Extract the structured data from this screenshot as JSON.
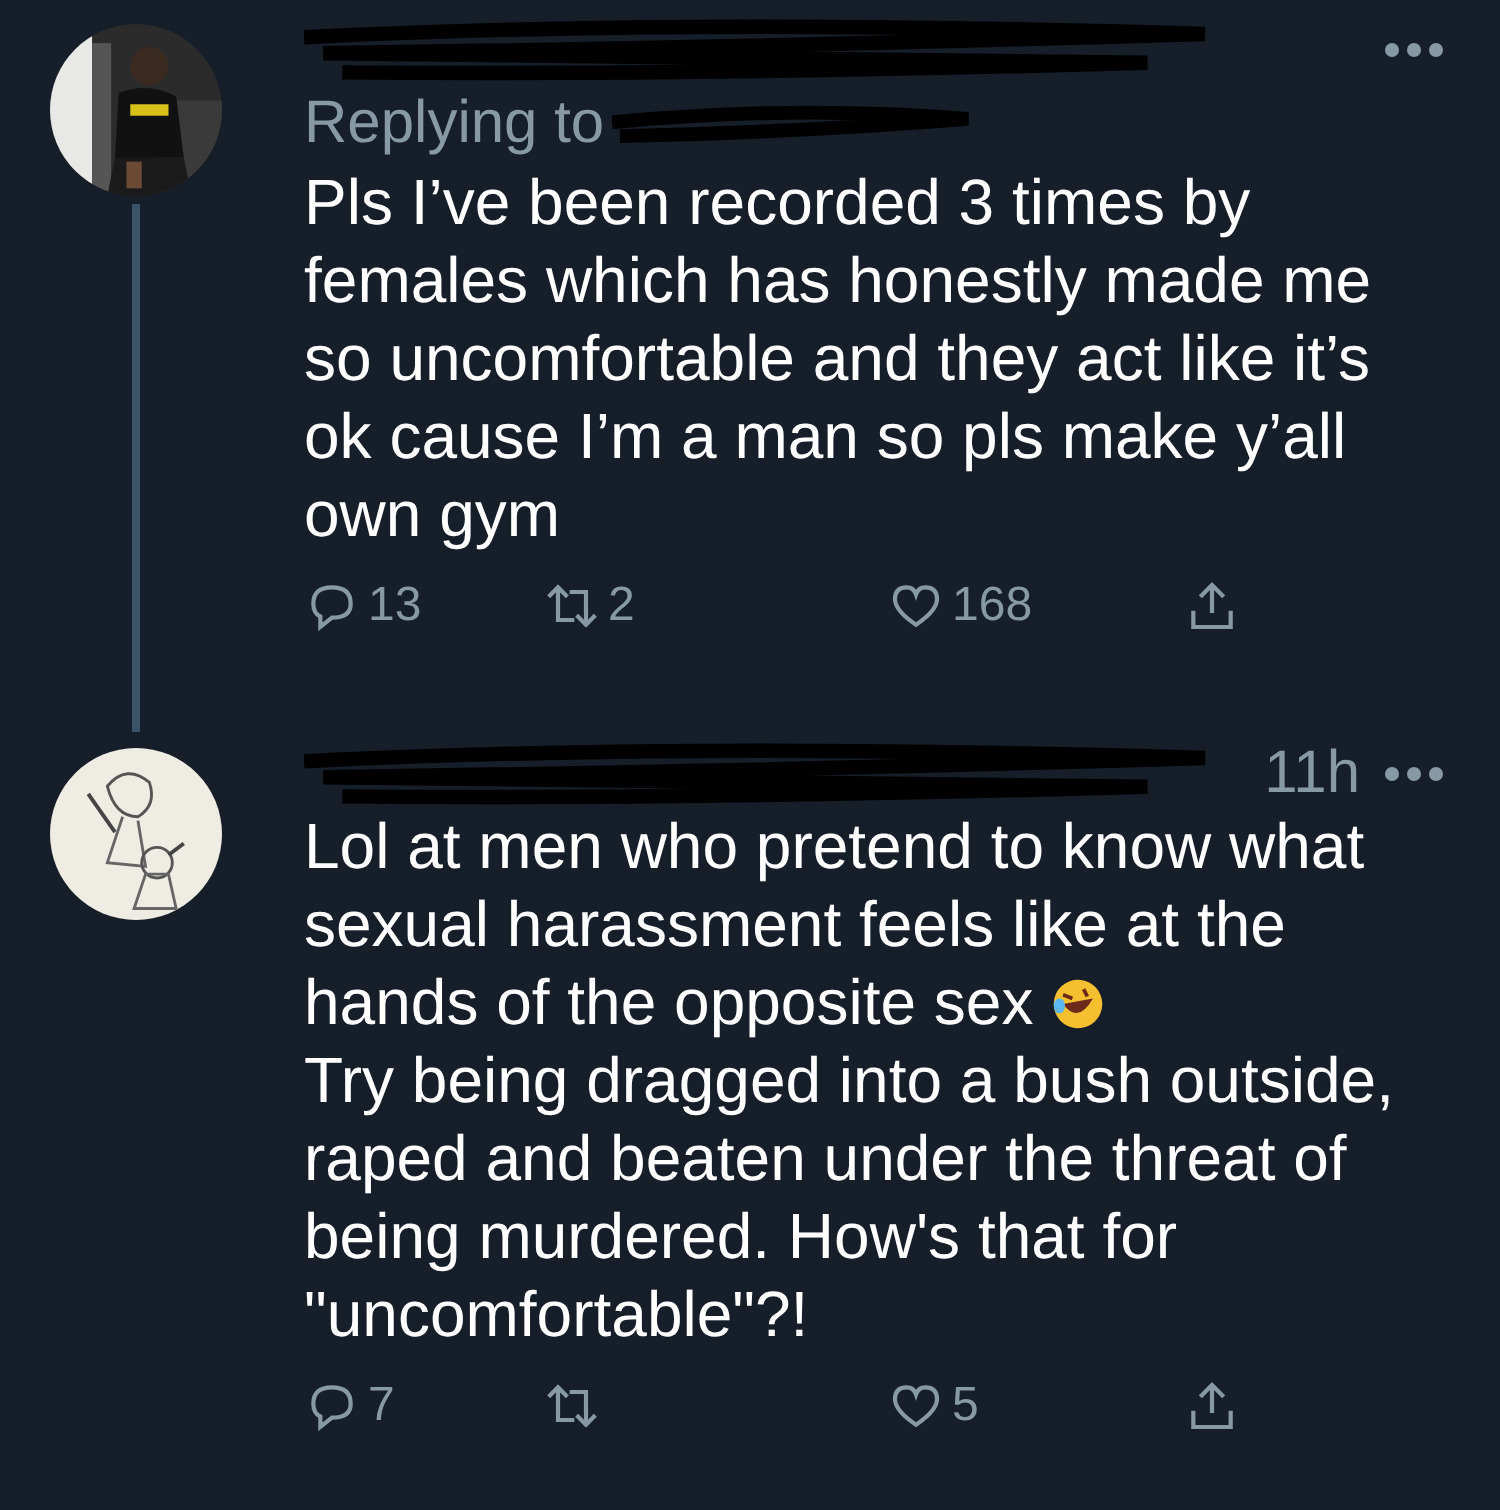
{
  "tweets": [
    {
      "replying_to": "Replying to",
      "thread_below": true,
      "paragraphs": [
        {
          "text": "Pls I’ve been recorded 3 times by females which has honestly made me so uncomfortable and they act like it’s ok cause I’m a man so pls make y’all own gym",
          "emoji": false
        }
      ],
      "replies": "13",
      "retweets": "2",
      "likes": "168"
    },
    {
      "time": "11h",
      "thread_below": false,
      "paragraphs": [
        {
          "text": "Lol at men who pretend to know what sexual harassment feels like at the hands of the opposite sex",
          "emoji": true
        },
        {
          "text": "Try being dragged into a bush outside, raped and beaten under the threat of being murdered. How's that for \"uncomfortable\"?!",
          "emoji": false
        }
      ],
      "replies": "7",
      "likes": "5"
    }
  ]
}
